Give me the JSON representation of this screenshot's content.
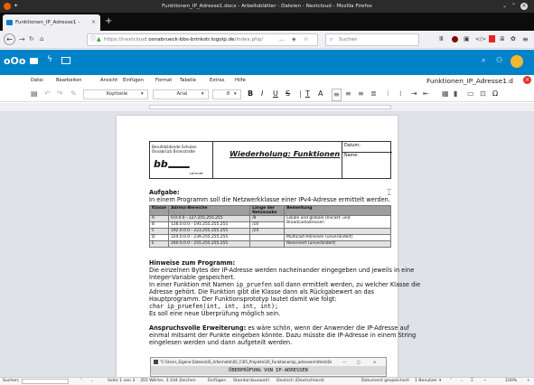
{
  "window": {
    "title": "Funktionen_IP_Adresse1.docx - Arbeitsblätter - Dateien - Nextcloud - Mozilla Firefox"
  },
  "browser": {
    "tab_title": "Funktionen_IP_Adresse1 - ",
    "url_prefix": "https://nextcloud.",
    "url_domain": "osnabrueck-bbs-brinkstr.logoip.de",
    "url_path": "/index.php/",
    "url_more": "…",
    "search_placeholder": "Suchen"
  },
  "editor": {
    "doc_name": "Funktionen_IP_Adresse1.d",
    "menu": [
      "Datei",
      "Bearbeiten",
      "Ansicht",
      "Einfügen",
      "Format",
      "Tabelle",
      "Extras",
      "Hilfe"
    ],
    "style_value": "Kopfzeile",
    "font_value": "Arial",
    "size_value": "8"
  },
  "document": {
    "school_line1": "Berufsbildende Schulen",
    "school_line2": "Osnabrück Brinkstraße",
    "logo_caption": "Lernnet",
    "header_title": "Wiederholung: Funktionen",
    "datum_label": "Datum:",
    "name_label": "Name:",
    "aufgabe_heading": "Aufgabe:",
    "aufgabe_text": "In einem Programm soll die Netzwerkklasse einer IPv4-Adresse ermittelt werden.",
    "table_headers": [
      "Klasse",
      "Adress-Bereiche",
      "Länge der Netzmaske",
      "Bemerkung"
    ],
    "table_rows": [
      [
        "A",
        "0.0.0.0 - 127.255.255.255",
        "/8",
        "Lokale und globale Unicast- und Broadcastadressen"
      ],
      [
        "B",
        "128.0.0.0 - 191.255.255.255",
        "/16",
        ""
      ],
      [
        "C",
        "192.0.0.0 - 223.255.255.255",
        "/24",
        ""
      ],
      [
        "D",
        "224.0.0.0 - 239.255.255.255",
        "",
        "Multicast-Adressen (unverändert)"
      ],
      [
        "E",
        "240.0.0.0 - 255.255.255.255",
        "",
        "Reserviert (unverändert)"
      ]
    ],
    "hinweise_heading": "Hinweise zum Programm:",
    "hinweise_p1a": "Die einzelnen Bytes der IP-Adresse werden nacheinander eingegeben und jeweils in eine",
    "hinweise_p1b": "Integer-Variable gespeichert.",
    "hinweise_p2a_pre": "In einer Funktion mit Namen ",
    "hinweise_p2a_code": "ip_pruefen",
    "hinweise_p2a_post": " soll dann ermittelt werden, zu welcher Klasse die",
    "hinweise_p2b": "Adresse gehört. Die Funktion gibt die Klasse dann als Rückgabewert an das",
    "hinweise_p2c": "Hauptprogramm. Der Funktionsprototyp lautet damit wie folgt:",
    "prototype_code": "char ip_pruefen(int, int, int, int);",
    "hinweise_p3": "Es soll eine neue Überprüfung möglich sein.",
    "anspruch_heading": "Anspruchsvolle Erweiterung:",
    "anspruch_l1": " es wäre schön, wenn der Anwender die IP-Adresse auf",
    "anspruch_l2": "einmal mitsamt der Punkte eingeben könnte. Dazu müsste die IP-Adresse in einem String",
    "anspruch_l3": "eingelesen werden und dann aufgeteilt werden.",
    "console_title": "\"C:\\Users_Eigene Dateien\\IG_Informatik\\02_C\\05_Projekte\\20_Funktionen\\ip_adressermitteln\\Debug\\ip_adresse.exe\"",
    "console_banner": "ÜBERPRÜFUNG VON IP-ADRESSEN"
  },
  "statusbar": {
    "search_label": "Suchen:",
    "page_info": "Seite 1 von 3",
    "word_info": "355 Wörter, 3.104 Zeichen",
    "insert_mode": "Einfügen",
    "selection_mode": "Standardauswahl",
    "language": "Deutsch (Deutschland)",
    "saved_info": "Dokument gespeichert:",
    "user_info": "1 Benutzer",
    "zoom": "100%"
  }
}
